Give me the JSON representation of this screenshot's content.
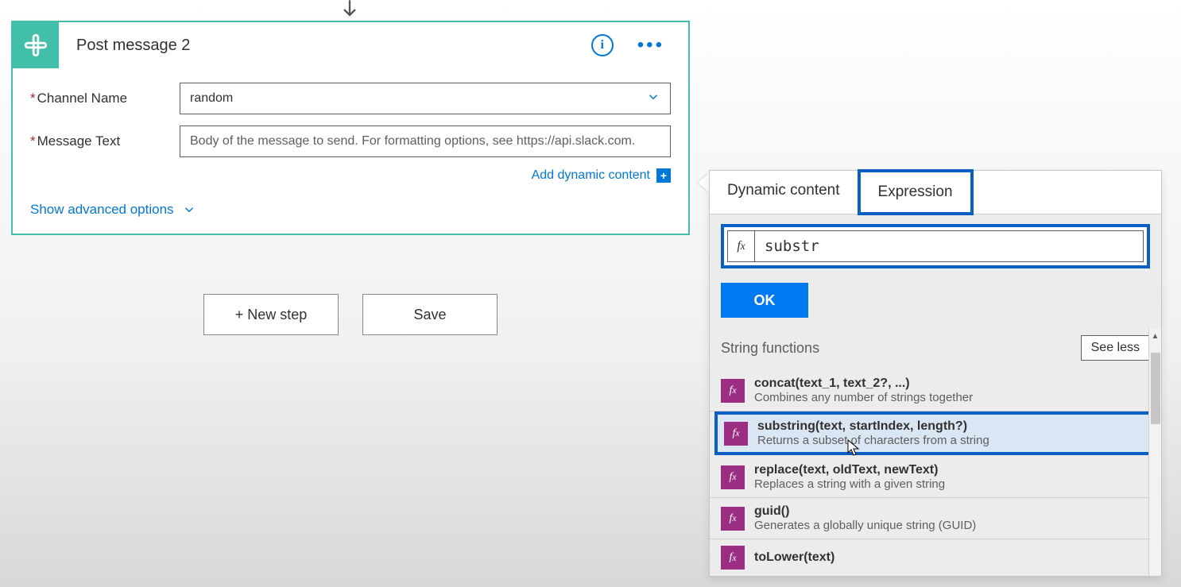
{
  "card": {
    "title": "Post message 2",
    "fields": {
      "channel_label": "Channel Name",
      "channel_value": "random",
      "message_label": "Message Text",
      "message_placeholder": "Body of the message to send. For formatting options, see https://api.slack.com."
    },
    "add_dynamic": "Add dynamic content",
    "show_advanced": "Show advanced options"
  },
  "buttons": {
    "new_step": "+ New step",
    "save": "Save"
  },
  "panel": {
    "tab_dynamic": "Dynamic content",
    "tab_expression": "Expression",
    "expr_value": "substr",
    "ok": "OK",
    "section_title": "String functions",
    "see_less": "See less",
    "functions": [
      {
        "sig": "concat(text_1, text_2?, ...)",
        "desc": "Combines any number of strings together"
      },
      {
        "sig": "substring(text, startIndex, length?)",
        "desc": "Returns a subset of characters from a string"
      },
      {
        "sig": "replace(text, oldText, newText)",
        "desc": "Replaces a string with a given string"
      },
      {
        "sig": "guid()",
        "desc": "Generates a globally unique string (GUID)"
      },
      {
        "sig": "toLower(text)",
        "desc": ""
      }
    ]
  }
}
